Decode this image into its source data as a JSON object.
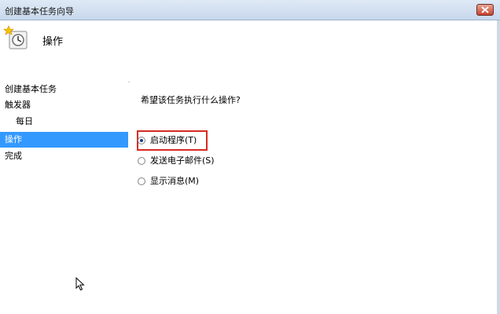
{
  "window": {
    "title": "创建基本任务向导"
  },
  "header": {
    "title": "操作",
    "icon": "task-clock-icon"
  },
  "nav": {
    "items": [
      {
        "label": "创建基本任务",
        "indent": false,
        "selected": false
      },
      {
        "label": "触发器",
        "indent": false,
        "selected": false
      },
      {
        "label": "每日",
        "indent": true,
        "selected": false
      },
      {
        "label": "操作",
        "indent": false,
        "selected": true
      },
      {
        "label": "完成",
        "indent": false,
        "selected": false
      }
    ]
  },
  "content": {
    "question": "希望该任务执行什么操作?",
    "options": [
      {
        "label": "启动程序(T)",
        "checked": true
      },
      {
        "label": "发送电子邮件(S)",
        "checked": false
      },
      {
        "label": "显示消息(M)",
        "checked": false
      }
    ]
  },
  "colors": {
    "selection": "#3399ff",
    "highlight_border": "#d62b22",
    "close_button": "#c7432f"
  }
}
